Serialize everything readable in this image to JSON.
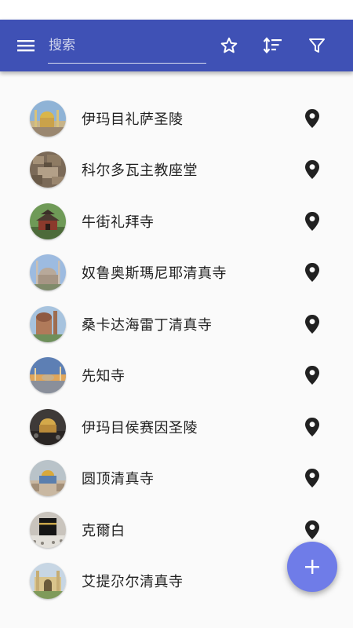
{
  "toolbar": {
    "background": "#3f51b5",
    "menu_icon": "menu-icon",
    "search_placeholder": "搜索",
    "search_value": "",
    "favorite_icon": "star-outline-icon",
    "sort_icon": "sort-icon",
    "filter_icon": "filter-icon"
  },
  "items": [
    {
      "name": "伊玛目礼萨圣陵",
      "location_icon": "map-marker-icon"
    },
    {
      "name": "科尔多瓦主教座堂",
      "location_icon": "map-marker-icon"
    },
    {
      "name": "牛街礼拜寺",
      "location_icon": "map-marker-icon"
    },
    {
      "name": "奴鲁奥斯瑪尼耶清真寺",
      "location_icon": "map-marker-icon"
    },
    {
      "name": "桑卡达海雷丁清真寺",
      "location_icon": "map-marker-icon"
    },
    {
      "name": "先知寺",
      "location_icon": "map-marker-icon"
    },
    {
      "name": "伊玛目侯赛因圣陵",
      "location_icon": "map-marker-icon"
    },
    {
      "name": "圆顶清真寺",
      "location_icon": "map-marker-icon"
    },
    {
      "name": "克爾白",
      "location_icon": "map-marker-icon"
    },
    {
      "name": "艾提尕尔清真寺",
      "location_icon": "map-marker-icon"
    }
  ],
  "fab": {
    "icon": "add-icon",
    "color": "#6f7ce8"
  }
}
